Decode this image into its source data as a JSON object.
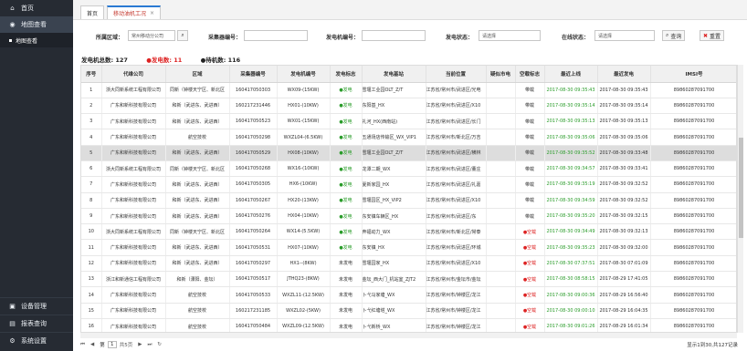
{
  "sidebar": {
    "items": [
      {
        "label": "首页",
        "icon": "home-icon"
      },
      {
        "label": "地图查看",
        "icon": "map-icon"
      }
    ],
    "sub": {
      "label": "地图查看"
    },
    "bottom": [
      {
        "label": "设备管理",
        "icon": "device-icon"
      },
      {
        "label": "报表查询",
        "icon": "report-icon"
      },
      {
        "label": "系统设置",
        "icon": "gear-icon"
      }
    ]
  },
  "tabs": {
    "home": "首页",
    "active": "移动油机工况",
    "close": "×"
  },
  "filters": {
    "area_label": "所属区域：",
    "area_value": "常州移动分公司",
    "collector_label": "采集器编号：",
    "collector_value": "",
    "genset_label": "发电机编号：",
    "genset_value": "",
    "power_label": "发电状态：",
    "power_value": "请选择",
    "online_label": "在线状态：",
    "online_value": "请选择",
    "search": "查询",
    "reset": "重置"
  },
  "stats": {
    "total": "发电机总数: 127",
    "generating": "●发电数: 11",
    "offline": "●待机数: 116"
  },
  "table": {
    "headers": [
      "序号",
      "代维公司",
      "区域",
      "采集器编号",
      "发电机编号",
      "发电标志",
      "发电基站",
      "当前位置",
      "疑似市电",
      "空载标志",
      "最近上线",
      "最近发电",
      "IMSI号"
    ],
    "rows": [
      [
        "1",
        "浙大同新系统工程有限公司",
        "同新（钟楼天宁区、新北区",
        "160417050303",
        "WX09-(15KW)",
        "●发电",
        "雪堰工业园OLT_Z/T",
        "江苏省/常州市/武进区/光电",
        "",
        "带载",
        "2017-08-30 09:35:43",
        "2017-08-30 09:35:43",
        "89860287091700"
      ],
      [
        "2",
        "广东和新科技有限公司",
        "和新（武进东、武进西）",
        "160217231446",
        "HX01-(10KW)",
        "●发电",
        "东阳基_HX",
        "江苏省/常州市/武进区/X10",
        "",
        "带载",
        "2017-08-30 09:35:14",
        "2017-08-30 09:35:14",
        "89860287091700"
      ],
      [
        "3",
        "广东和新科技有限公司",
        "和新（武进东、武进西）",
        "160417050523",
        "WX01-(15KW)",
        "●发电",
        "礼河_HX(西南站)",
        "江苏省/常州市/武进区/长门",
        "",
        "带载",
        "2017-08-30 09:35:13",
        "2017-08-30 09:35:13",
        "89860287091700"
      ],
      [
        "4",
        "广东和新科技有限公司",
        "航空技校",
        "160417050298",
        "WXZL04-(6.5KW)",
        "●发电",
        "五通场店传输区_WX_VIP1",
        "江苏省/常州市/新北区/万吉",
        "",
        "带载",
        "2017-08-30 09:35:06",
        "2017-08-30 09:35:06",
        "89860287091700"
      ],
      [
        "5",
        "广东和新科技有限公司",
        "和新（武进东、武进西）",
        "160417050529",
        "HX08-(10KW)",
        "●发电",
        "雪堰工业园OLT_Z/T",
        "江苏省/常州市/武进区/横林",
        "",
        "带载",
        "2017-08-30 09:35:52",
        "2017-08-30 09:33:48",
        "89860287091700"
      ],
      [
        "6",
        "浙大同新系统工程有限公司",
        "同新（钟楼天宁区、新北区",
        "160417050268",
        "WX16-(10KW)",
        "●发电",
        "龙潭二期_WX",
        "江苏省/常州市/武进区/董庄",
        "",
        "带载",
        "2017-08-30 09:34:57",
        "2017-08-30 09:33:41",
        "89860287091700"
      ],
      [
        "7",
        "广东和新科技有限公司",
        "和新（武进东、武进西）",
        "160417050305",
        "HX6-(10KW)",
        "●发电",
        "夏新家园_HX",
        "江苏省/常州市/武进区/礼嘉",
        "",
        "带载",
        "2017-08-30 09:35:19",
        "2017-08-30 09:32:52",
        "89860287091700"
      ],
      [
        "8",
        "广东和新科技有限公司",
        "和新（武进东、武进西）",
        "160417050267",
        "HX20-(13KW)",
        "●发电",
        "雪堰园区_HX_VIP2",
        "江苏省/常州市/武进区/X10",
        "",
        "带载",
        "2017-08-30 09:34:59",
        "2017-08-30 09:32:52",
        "89860287091700"
      ],
      [
        "9",
        "广东和新科技有限公司",
        "和新（武进东、武进西）",
        "160417050276",
        "HX04-(10KW)",
        "●发电",
        "东安镇车辆区_HX",
        "江苏省/常州市/武进区/东",
        "",
        "带载",
        "2017-08-30 09:35:20",
        "2017-08-30 09:32:15",
        "89860287091700"
      ],
      [
        "10",
        "浙大同新系统工程有限公司",
        "同新（钟楼天宁区、新北区",
        "160417050264",
        "WX14-(5.5KW)",
        "●发电",
        "奔福动力_WX",
        "江苏省/常州市/新北区/常泰",
        "",
        "●空载",
        "2017-08-30 09:34:49",
        "2017-08-30 09:32:13",
        "89860287091700"
      ],
      [
        "11",
        "广东和新科技有限公司",
        "和新（武进东、武进西）",
        "160417050531",
        "HX07-(10KW)",
        "●发电",
        "东安镇_HX",
        "江苏省/常州市/武进区/环城",
        "",
        "●空载",
        "2017-08-30 09:35:23",
        "2017-08-30 09:32:00",
        "89860287091700"
      ],
      [
        "12",
        "广东和新科技有限公司",
        "和新（武进东、武进西）",
        "160417050297",
        "HX1--(8KW)",
        "未发电",
        "雪堰园家_HX",
        "江苏省/常州市/武进区/X10",
        "",
        "●空载",
        "2017-08-30 07:37:51",
        "2017-08-30 07:01:09",
        "89860287091700"
      ],
      [
        "13",
        "浙江和新通信工程有限公司",
        "和新（溧阳、金坛）",
        "160417050517",
        "JTHQ23-(8KW)",
        "未发电",
        "金坛_西大门_机站室_ZJT2",
        "江苏省/常州市/金坛市/金坛",
        "",
        "●空载",
        "2017-08-30 08:58:15",
        "2017-08-29 17:41:05",
        "89860287091700"
      ],
      [
        "14",
        "广东和新科技有限公司",
        "航空技校",
        "160417050533",
        "WXZL11-(12.5KW)",
        "未发电",
        "卜弋马家塘_WX",
        "江苏省/常州市/钟楼区/龙江",
        "",
        "●空载",
        "2017-08-30 09:00:36",
        "2017-08-29 16:56:40",
        "89860287091700"
      ],
      [
        "15",
        "广东和新科技有限公司",
        "航空技校",
        "160217231185",
        "WXZL02-(5KW)",
        "未发电",
        "卜弋红塘塔_WX",
        "江苏省/常州市/钟楼区/龙江",
        "",
        "●空载",
        "2017-08-30 09:00:10",
        "2017-08-29 16:04:35",
        "89860287091700"
      ],
      [
        "16",
        "广东和新科技有限公司",
        "航空技校",
        "160417050484",
        "WXZL09-(12.5KW)",
        "未发电",
        "卜弋新桥_WX",
        "江苏省/常州市/钟楼区/龙江",
        "",
        "●空载",
        "2017-08-30 09:01:26",
        "2017-08-29 16:01:34",
        "89860287091700"
      ]
    ]
  },
  "pager": {
    "first": "⏮",
    "prev": "◀",
    "page_label": "第",
    "page": "1",
    "of": "共5页",
    "next": "▶",
    "last": "⏭",
    "refresh": "↻",
    "summary": "显示1到30,共127记录"
  },
  "colors": {
    "sidebar": "#262b33",
    "green": "#2a9c2a",
    "red": "#dd2222",
    "tab_active": "#c4362c"
  }
}
